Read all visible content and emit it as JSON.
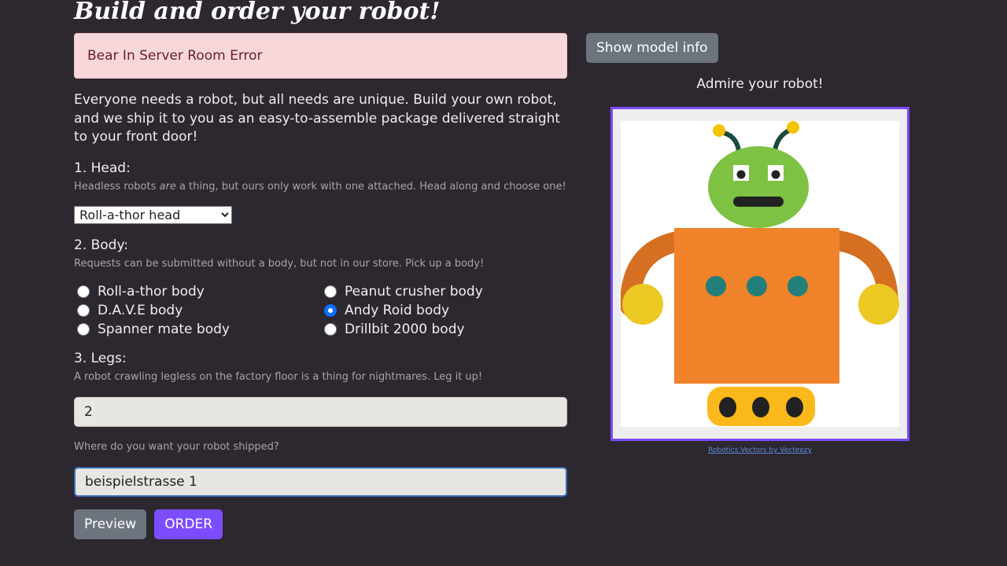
{
  "page": {
    "title": "Build and order your robot!"
  },
  "alert": {
    "text": "Bear In Server Room Error"
  },
  "intro": {
    "text": "Everyone needs a robot, but all needs are unique. Build your own robot, and we ship it to you as an easy-to-assemble package delivered straight to your front door!"
  },
  "head": {
    "label": "1. Head:",
    "hint_before": "Headless robots ",
    "hint_em": "are",
    "hint_after": " a thing, but ours only work with one attached. Head along and choose one!",
    "selected": "Roll-a-thor head"
  },
  "body": {
    "label": "2. Body:",
    "hint": "Requests can be submitted without a body, but not in our store. Pick up a body!",
    "options": [
      {
        "label": "Roll-a-thor body",
        "checked": false
      },
      {
        "label": "Peanut crusher body",
        "checked": false
      },
      {
        "label": "D.A.V.E body",
        "checked": false
      },
      {
        "label": "Andy Roid body",
        "checked": true
      },
      {
        "label": "Spanner mate body",
        "checked": false
      },
      {
        "label": "Drillbit 2000 body",
        "checked": false
      }
    ]
  },
  "legs": {
    "label": "3. Legs:",
    "hint": "A robot crawling legless on the factory floor is a thing for nightmares. Leg it up!",
    "value": "2"
  },
  "address": {
    "hint": "Where do you want your robot shipped?",
    "value": "beispielstrasse 1"
  },
  "buttons": {
    "preview": "Preview",
    "order": "ORDER",
    "model_info": "Show model info"
  },
  "preview": {
    "admire": "Admire your robot!",
    "credit": "Robotics Vectors by Vecteezy"
  },
  "colors": {
    "background": "#2d2730",
    "accent": "#7c4dff",
    "alert_bg": "#f8d7da",
    "robot_head": "#7dc242",
    "robot_body": "#f0822a",
    "robot_arms": "#d56f22",
    "robot_hands": "#ecc823",
    "robot_buttons": "#237f7a",
    "robot_legs": "#fbb81a"
  }
}
